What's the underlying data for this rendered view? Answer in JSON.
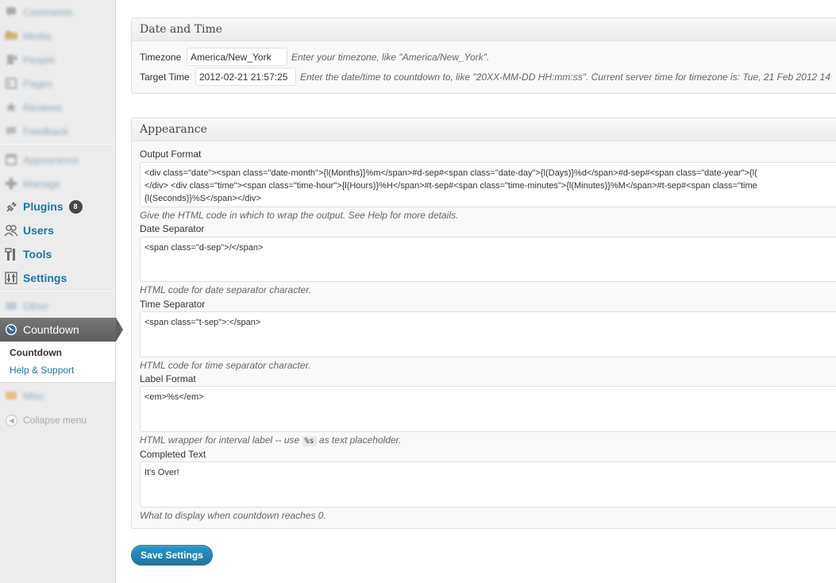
{
  "sidebar": {
    "blurred_items": [
      {
        "label": "Comments",
        "icon": "comments-icon"
      },
      {
        "label": "Media",
        "icon": "media-icon"
      },
      {
        "label": "People",
        "icon": "people-icon"
      },
      {
        "label": "Pages",
        "icon": "pages-icon"
      },
      {
        "label": "Reviews",
        "icon": "reviews-icon"
      },
      {
        "label": "Feedback",
        "icon": "feedback-icon"
      },
      {
        "label": "Appearance",
        "icon": "appearance-icon"
      },
      {
        "label": "Manage",
        "icon": "manage-icon"
      }
    ],
    "items": [
      {
        "label": "Plugins",
        "icon": "plugin-icon",
        "badge": "8"
      },
      {
        "label": "Users",
        "icon": "users-icon"
      },
      {
        "label": "Tools",
        "icon": "tools-icon"
      },
      {
        "label": "Settings",
        "icon": "settings-icon"
      }
    ],
    "blurred_after": [
      {
        "label": "Other",
        "icon": "other-icon"
      }
    ],
    "current": {
      "label": "Countdown",
      "icon": "clock-icon"
    },
    "submenu": [
      {
        "label": "Countdown",
        "current": true
      },
      {
        "label": "Help & Support",
        "current": false
      }
    ],
    "blurred_last": {
      "label": "Misc",
      "icon": "misc-icon"
    },
    "collapse_label": "Collapse menu"
  },
  "datetime": {
    "title": "Date and Time",
    "timezone_label": "Timezone",
    "timezone_value": "America/New_York",
    "timezone_hint": "Enter your timezone, like \"America/New_York\".",
    "target_label": "Target Time",
    "target_value": "2012-02-21 21:57:25",
    "target_hint": "Enter the date/time to countdown to, like \"20XX-MM-DD HH:mm:ss\". Current server time for timezone is: Tue, 21 Feb 2012 14"
  },
  "appearance": {
    "title": "Appearance",
    "output_label": "Output Format",
    "output_lines": [
      "<div class=\"date\"><span class=\"date-month\">{l(Months)}%m</span>#d-sep#<span class=\"date-day\">{l(Days)}%d</span>#d-sep#<span class=\"date-year\">{l(",
      "</div> <div class=\"time\"><span class=\"time-hour\">{l(Hours)}%H</span>#t-sep#<span class=\"time-minutes\">{l(Minutes)}%M</span>#t-sep#<span class=\"time",
      "{l(Seconds)}%S</span></div>"
    ],
    "output_hint": "Give the HTML code in which to wrap the output. See Help for more details.",
    "date_sep_label": "Date Separator",
    "date_sep_value": "<span class=\"d-sep\">/</span>",
    "date_sep_hint": "HTML code for date separator character.",
    "time_sep_label": "Time Separator",
    "time_sep_value": "<span class=\"t-sep\">:</span>",
    "time_sep_hint": "HTML code for time separator character.",
    "label_format_label": "Label Format",
    "label_format_value": "<em>%s</em>",
    "label_format_hint_pre": "HTML wrapper for interval label -- use",
    "label_format_hint_code": "%s",
    "label_format_hint_post": "as text placeholder.",
    "completed_label": "Completed Text",
    "completed_value": "It's Over!",
    "completed_hint": "What to display when countdown reaches 0."
  },
  "save_label": "Save Settings",
  "colors": {
    "link": "#21759b",
    "current_menu_bg": "#6d6d6d",
    "button": "#21759b"
  }
}
